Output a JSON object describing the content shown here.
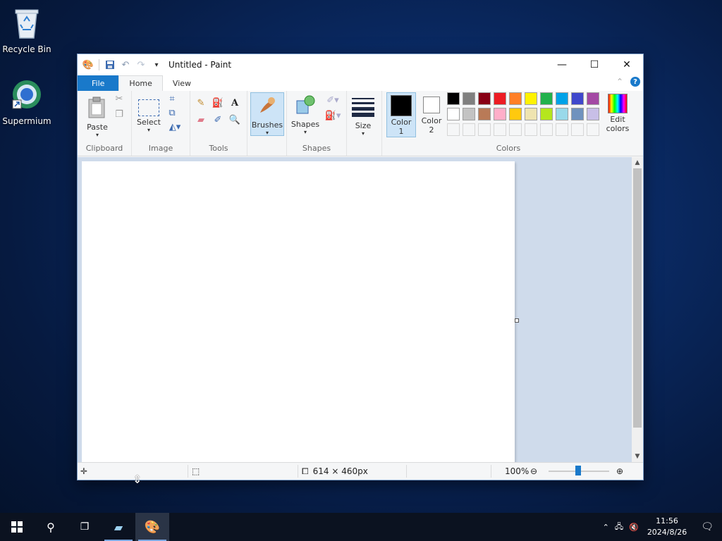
{
  "desktop": {
    "icons": [
      {
        "label": "Recycle Bin",
        "icon": "recycle-bin-icon"
      },
      {
        "label": "Supermium",
        "icon": "supermium-browser-icon"
      }
    ]
  },
  "window": {
    "title": "Untitled - Paint",
    "controls": {
      "minimize": "—",
      "maximize": "☐",
      "close": "✕"
    }
  },
  "ribbon": {
    "tabs": [
      "File",
      "Home",
      "View"
    ],
    "active_tab": "Home",
    "groups": {
      "clipboard": {
        "title": "Clipboard",
        "paste": "Paste"
      },
      "image": {
        "title": "Image",
        "select": "Select"
      },
      "tools": {
        "title": "Tools"
      },
      "brushes": {
        "label": "Brushes"
      },
      "shapes": {
        "title": "Shapes",
        "label": "Shapes"
      },
      "size": {
        "label": "Size"
      },
      "colors": {
        "title": "Colors",
        "color1": "Color",
        "color1_num": "1",
        "color2": "Color",
        "color2_num": "2",
        "edit_colors": "Edit",
        "edit_colors2": "colors",
        "color1_value": "#000000",
        "color2_value": "#ffffff",
        "palette_row1": [
          "#000000",
          "#7f7f7f",
          "#880015",
          "#ed1c24",
          "#ff7f27",
          "#fff200",
          "#22b14c",
          "#00a2e8",
          "#3f48cc",
          "#a349a4"
        ],
        "palette_row2": [
          "#ffffff",
          "#c3c3c3",
          "#b97a57",
          "#ffaec9",
          "#ffc90e",
          "#efe4b0",
          "#b5e61d",
          "#99d9ea",
          "#7092be",
          "#c8bfe7"
        ]
      }
    }
  },
  "status": {
    "image_size": "614 × 460px",
    "zoom": "100%"
  },
  "taskbar": {
    "time": "11:56",
    "date": "2024/8/26"
  }
}
